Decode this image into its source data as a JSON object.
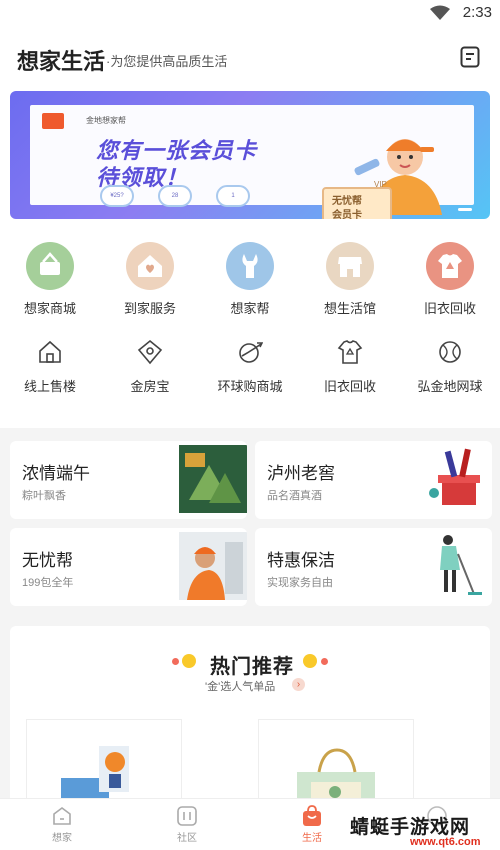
{
  "status": {
    "time": "2:33"
  },
  "header": {
    "title": "想家生活",
    "subtitle": "·为您提供高品质生活"
  },
  "banner": {
    "brand": "金地想家帮",
    "headline_line1": "您有一张会员卡",
    "headline_line2": "待领取！",
    "pills": [
      "¥25?",
      "28",
      "1"
    ],
    "vip_card": {
      "tag": "VIP",
      "line1": "无忧帮",
      "line2": "会员卡"
    }
  },
  "services": [
    {
      "label": "想家商城",
      "icon": "basket-icon",
      "color": "#a5cf9a"
    },
    {
      "label": "到家服务",
      "icon": "house-heart-icon",
      "color": "#eed3bd"
    },
    {
      "label": "想家帮",
      "icon": "wrench-icon",
      "color": "#9fc6e8"
    },
    {
      "label": "想生活馆",
      "icon": "shop-icon",
      "color": "#e9d7c2"
    },
    {
      "label": "旧衣回收",
      "icon": "shirt-icon",
      "color": "#e99382"
    }
  ],
  "quick_links": [
    {
      "label": "线上售楼",
      "icon": "home-outline-icon"
    },
    {
      "label": "金房宝",
      "icon": "tag-icon"
    },
    {
      "label": "环球购商城",
      "icon": "globe-plane-icon"
    },
    {
      "label": "旧衣回收",
      "icon": "shirt-outline-icon"
    },
    {
      "label": "弘金地网球",
      "icon": "tennis-ball-icon"
    }
  ],
  "promos": [
    {
      "title": "浓情端午",
      "subtitle": "粽叶飘香"
    },
    {
      "title": "泸州老窖",
      "subtitle": "品名酒真酒"
    },
    {
      "title": "无忧帮",
      "subtitle": "199包全年"
    },
    {
      "title": "特惠保洁",
      "subtitle": "实现家务自由"
    }
  ],
  "hot": {
    "title": "热门推荐",
    "subtitle": "'金'选人气单品",
    "arrow": "›"
  },
  "tabs": [
    {
      "label": "想家",
      "icon": "home-tab-icon",
      "active": false
    },
    {
      "label": "社区",
      "icon": "community-tab-icon",
      "active": false
    },
    {
      "label": "生活",
      "icon": "bag-tab-icon",
      "active": true
    },
    {
      "label": "",
      "icon": "profile-tab-icon",
      "active": false
    }
  ],
  "watermark": {
    "text": "蜻蜓手游戏网",
    "url": "www.qt6.com"
  },
  "colors": {
    "accent": "#f06a4a",
    "banner_purple": "#5a4fd9"
  }
}
